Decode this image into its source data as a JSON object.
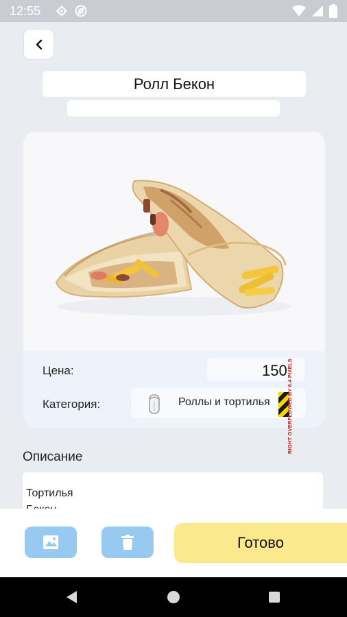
{
  "status_bar": {
    "time": "12:55",
    "icons": [
      "settings-gear-icon",
      "at-sign-icon",
      "wifi-icon",
      "cellular-signal-icon",
      "battery-icon"
    ]
  },
  "header": {
    "back_icon": "chevron-left-icon",
    "title": "Ролл Бекон",
    "subtitle": ""
  },
  "product_card": {
    "image": "wrap-roll-photo",
    "price_label": "Цена:",
    "price_value": "150",
    "category_label": "Категория:",
    "category_icon": "roll-icon",
    "category_value": "Роллы и тортилья",
    "overflow_warning": "RIGHT OVERFLOWED BY 6.4 PIXELS"
  },
  "description": {
    "label": "Описание",
    "line1": "Тортилья",
    "line2": "Бекон"
  },
  "actions": {
    "image_icon": "image-icon",
    "delete_icon": "trash-icon",
    "done_label": "Готово"
  },
  "colors": {
    "background": "#e9ecf1",
    "action_blue": "#97c9f1",
    "done_yellow": "#fde98d",
    "status_bar": "#c9ccd2"
  }
}
